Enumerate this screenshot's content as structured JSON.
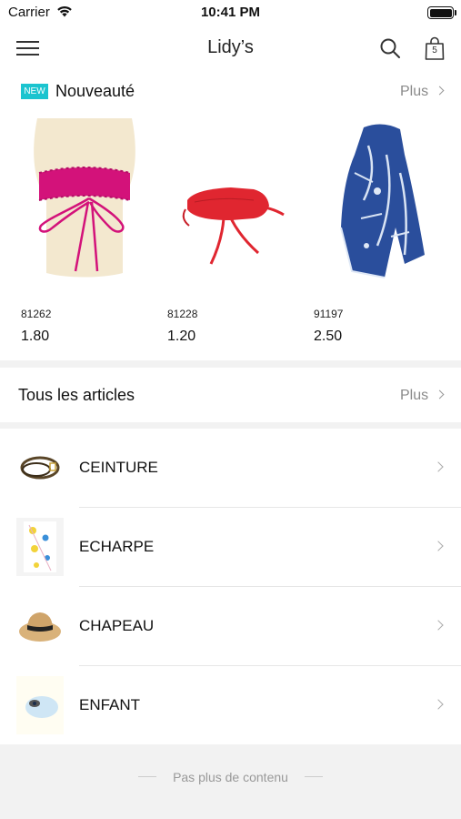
{
  "status_bar": {
    "carrier": "Carrier",
    "time": "10:41 PM"
  },
  "nav": {
    "title": "Lidy’s",
    "cart_count": "5",
    "icons": [
      "menu-icon",
      "search-icon",
      "shopping-bag-icon"
    ]
  },
  "new_section": {
    "badge": "NEW",
    "heading": "Nouveauté",
    "more_label": "Plus",
    "products": [
      {
        "code": "81262",
        "price": "1.80",
        "image": "pink-lace-wrap-belt"
      },
      {
        "code": "81228",
        "price": "1.20",
        "image": "red-leather-wrap-belt"
      },
      {
        "code": "91197",
        "price": "2.50",
        "image": "blue-printed-scarf"
      }
    ]
  },
  "all_section": {
    "heading": "Tous les articles",
    "more_label": "Plus"
  },
  "categories": [
    {
      "label": "CEINTURE",
      "image": "belt"
    },
    {
      "label": "ECHARPE",
      "image": "scarf"
    },
    {
      "label": "CHAPEAU",
      "image": "straw-hat"
    },
    {
      "label": "ENFANT",
      "image": "kids-accessory"
    }
  ],
  "footer": {
    "text": "Pas plus de contenu"
  },
  "colors": {
    "accent_badge": "#1bc4cf",
    "background": "#f2f2f2",
    "muted_text": "#8a8a8a"
  }
}
